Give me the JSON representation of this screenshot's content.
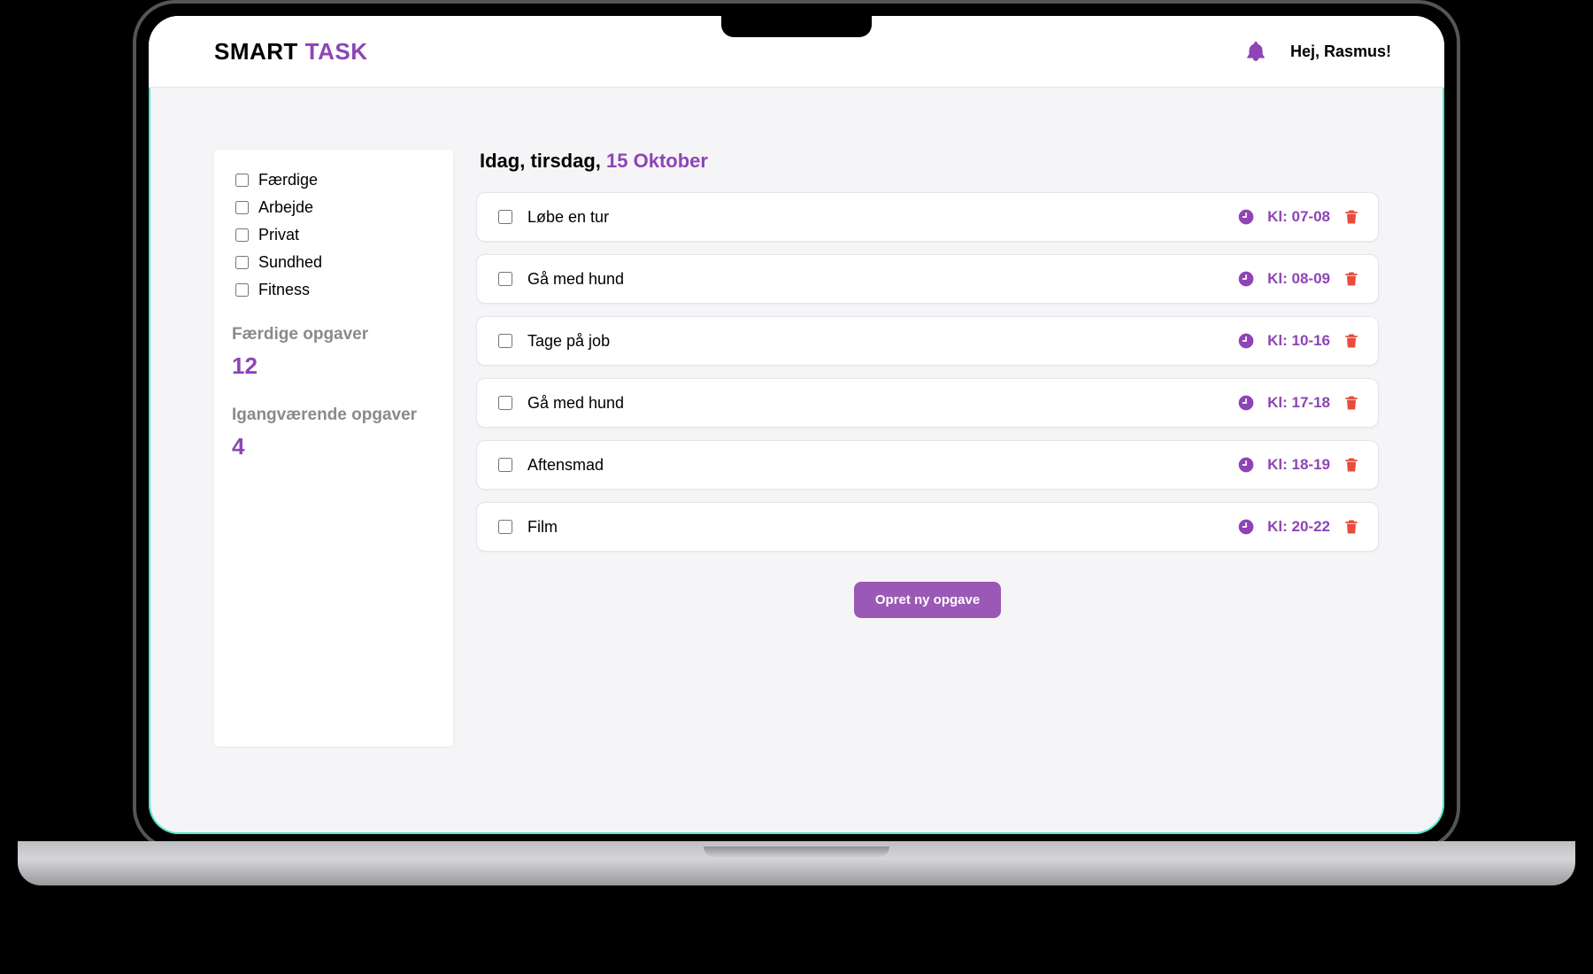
{
  "brand": {
    "word1": "SMART",
    "word2": "TASK"
  },
  "header": {
    "greeting": "Hej, Rasmus!"
  },
  "sidebar": {
    "filters": [
      {
        "label": "Færdige"
      },
      {
        "label": "Arbejde"
      },
      {
        "label": "Privat"
      },
      {
        "label": "Sundhed"
      },
      {
        "label": "Fitness"
      }
    ],
    "completed_label": "Færdige opgaver",
    "completed_count": "12",
    "pending_label": "Igangværende opgaver",
    "pending_count": "4"
  },
  "main": {
    "date_prefix": "Idag, tirsdag, ",
    "date_accent": "15 Oktober"
  },
  "tasks": [
    {
      "title": "Løbe en tur",
      "time": "Kl: 07-08"
    },
    {
      "title": "Gå med hund",
      "time": "Kl: 08-09"
    },
    {
      "title": "Tage på job",
      "time": "Kl: 10-16"
    },
    {
      "title": "Gå med hund",
      "time": "Kl: 17-18"
    },
    {
      "title": "Aftensmad",
      "time": "Kl: 18-19"
    },
    {
      "title": "Film",
      "time": "Kl: 20-22"
    }
  ],
  "actions": {
    "create_task": "Opret ny opgave"
  }
}
